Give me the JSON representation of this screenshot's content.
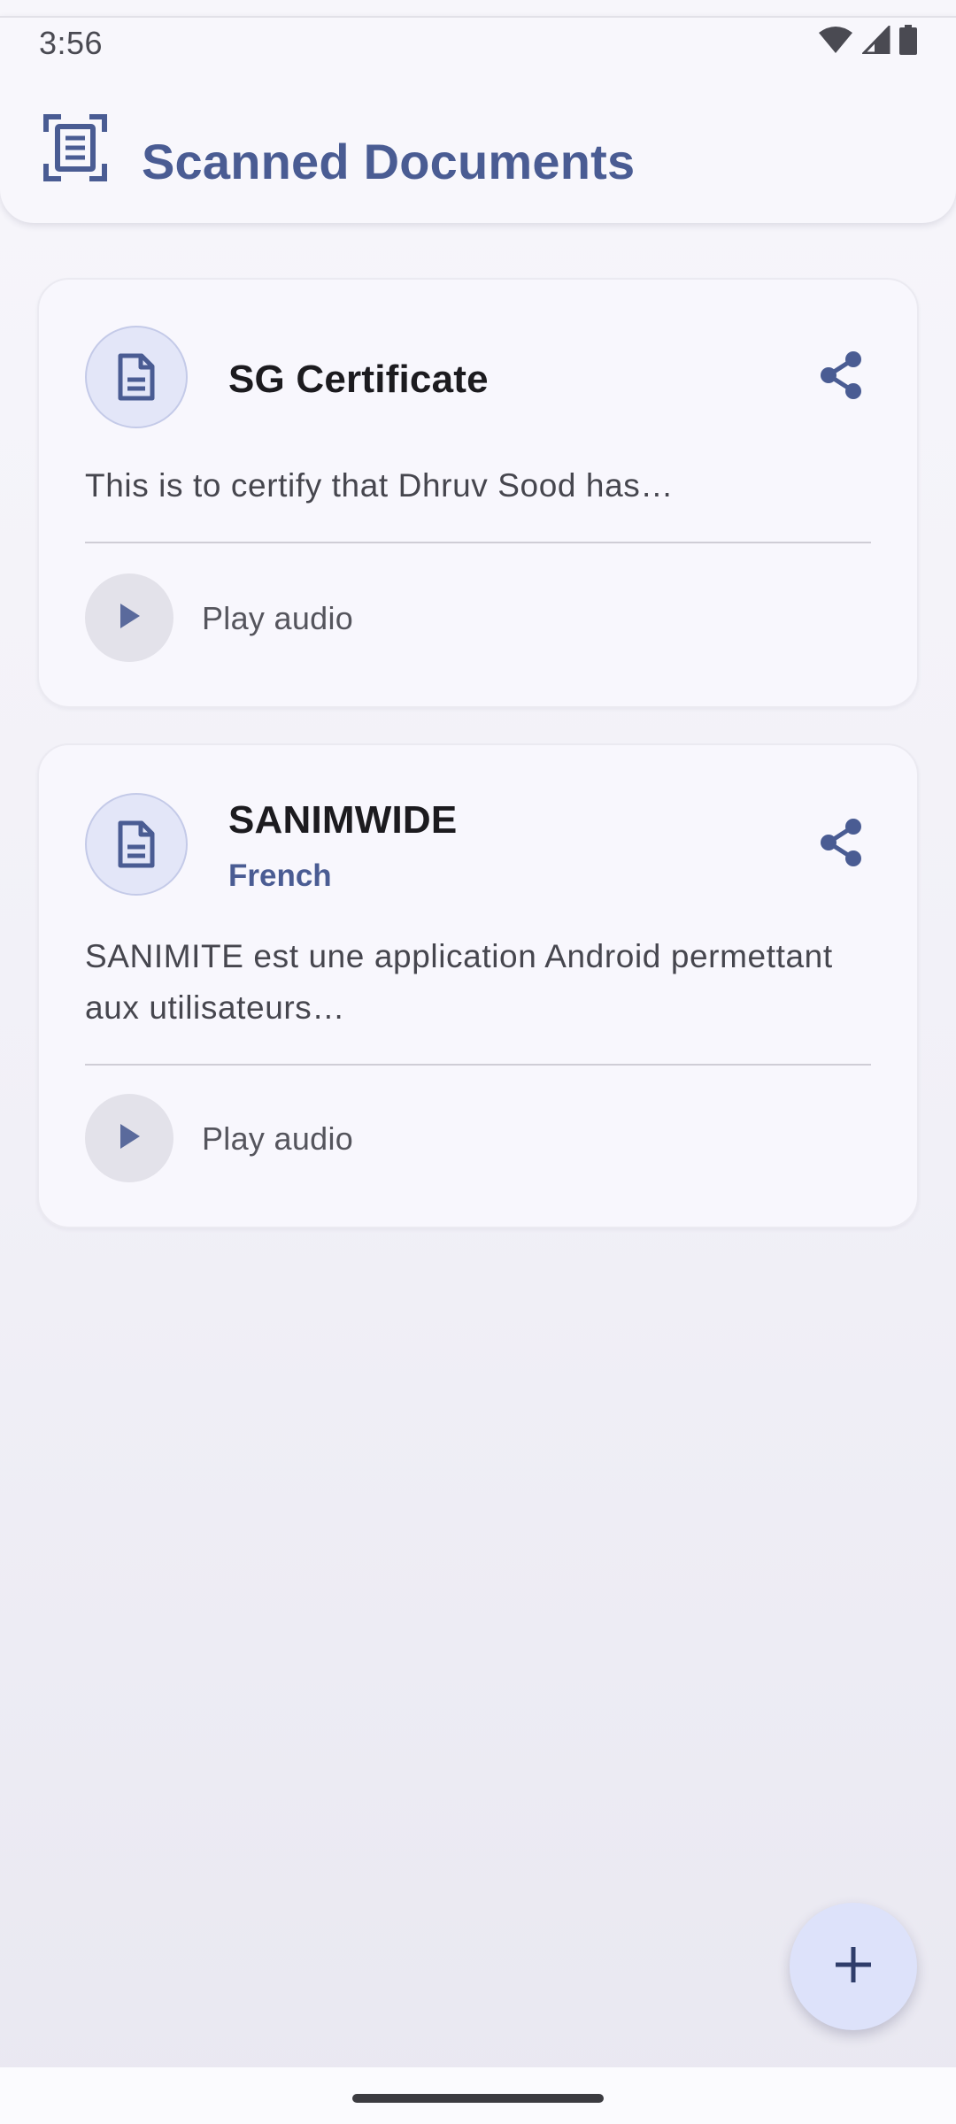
{
  "status_bar": {
    "time": "3:56",
    "icons": [
      "wifi-icon",
      "cellular-signal-icon",
      "battery-icon"
    ]
  },
  "header": {
    "icon": "document-scanner-icon",
    "title": "Scanned Documents"
  },
  "documents": [
    {
      "title": "SG Certificate",
      "language": "",
      "excerpt": "This is to certify that Dhruv Sood has…",
      "play_label": "Play audio",
      "icon": "document-icon",
      "share_icon": "share-icon"
    },
    {
      "title": "SANIMWIDE",
      "language": "French",
      "excerpt": "SANIMITE est une application Android permettant aux utilisateurs…",
      "play_label": "Play audio",
      "icon": "document-icon",
      "share_icon": "share-icon"
    }
  ],
  "fab": {
    "icon": "plus-icon"
  },
  "colors": {
    "primary": "#4a5c93",
    "avatar_bg": "#e3e6f8",
    "fab_bg": "#dde2fa",
    "card_bg": "#f8f7fd"
  }
}
